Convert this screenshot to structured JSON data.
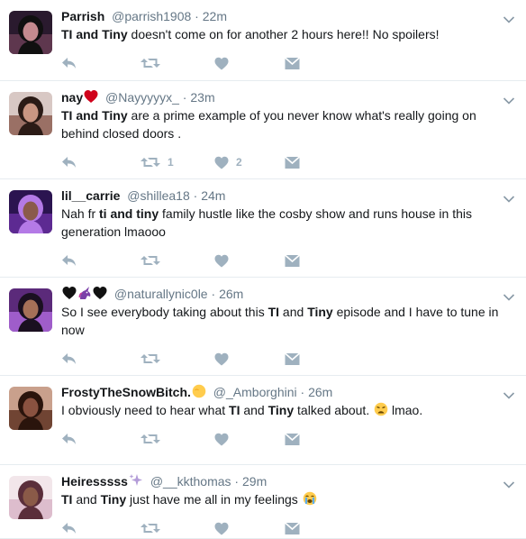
{
  "tweets": [
    {
      "name": "Parrish",
      "handle": "@parrish1908",
      "time": "22m",
      "avatar": "avatar-woman-dark-hair",
      "body": [
        {
          "t": "TI and Tiny",
          "b": true
        },
        {
          "t": " doesn't come on for another 2 hours here!! No spoilers!",
          "b": false
        }
      ],
      "retweets": "",
      "likes": ""
    },
    {
      "name": "nay",
      "name_emoji": "red-heart",
      "handle": "@Nayyyyyx_",
      "time": "23m",
      "avatar": "avatar-woman-lying",
      "body": [
        {
          "t": "TI and Tiny",
          "b": true
        },
        {
          "t": " are a prime example of you never know what's really going on behind closed doors .",
          "b": false
        }
      ],
      "retweets": "1",
      "likes": "2"
    },
    {
      "name": "lil__carrie",
      "handle": "@shillea18",
      "time": "24m",
      "avatar": "avatar-purple-flower-crown",
      "body": [
        {
          "t": "Nah fr ",
          "b": false
        },
        {
          "t": "ti and tiny",
          "b": true
        },
        {
          "t": " family  hustle  like the cosby  show and runs  house in this generation lmaooo",
          "b": false
        }
      ],
      "retweets": "",
      "likes": ""
    },
    {
      "name": "",
      "name_emojis": [
        "black-heart",
        "unicorn",
        "black-heart"
      ],
      "handle": "@naturallynic0le",
      "time": "26m",
      "avatar": "avatar-woman-purple-light",
      "body": [
        {
          "t": "So I see everybody taking about this ",
          "b": false
        },
        {
          "t": "TI",
          "b": true
        },
        {
          "t": " and ",
          "b": false
        },
        {
          "t": "Tiny",
          "b": true
        },
        {
          "t": " episode and I have to tune in now",
          "b": false
        }
      ],
      "retweets": "",
      "likes": ""
    },
    {
      "name": "FrostyTheSnowBitch.",
      "name_emoji": "yellow-face",
      "handle": "@_Amborghini",
      "time": "26m",
      "avatar": "avatar-woman-curly-hair",
      "body": [
        {
          "t": "I obviously need to hear what ",
          "b": false
        },
        {
          "t": "TI",
          "b": true
        },
        {
          "t": " and ",
          "b": false
        },
        {
          "t": "Tiny",
          "b": true
        },
        {
          "t": " talked about. ",
          "b": false
        },
        {
          "t": "[emoji:weary-face]",
          "b": false
        },
        {
          "t": " lmao.",
          "b": false
        }
      ],
      "retweets": "",
      "likes": ""
    },
    {
      "name": "Heiresssss",
      "name_emoji": "sparkles",
      "handle": "@__kkthomas",
      "time": "29m",
      "avatar": "avatar-woman-selfie",
      "body": [
        {
          "t": "TI",
          "b": true
        },
        {
          "t": " and ",
          "b": false
        },
        {
          "t": "Tiny",
          "b": true
        },
        {
          "t": " just have me all in my feelings ",
          "b": false
        },
        {
          "t": "[emoji:crying-face]",
          "b": false
        }
      ],
      "retweets": "",
      "likes": ""
    }
  ],
  "icons": {
    "reply": "reply-icon",
    "retweet": "retweet-icon",
    "like": "heart-icon",
    "message": "envelope-icon",
    "more": "chevron-down-icon"
  },
  "colors": {
    "name": "#14171a",
    "meta": "#657786",
    "action": "#9fb1bf",
    "divider": "#e6ecf0"
  }
}
